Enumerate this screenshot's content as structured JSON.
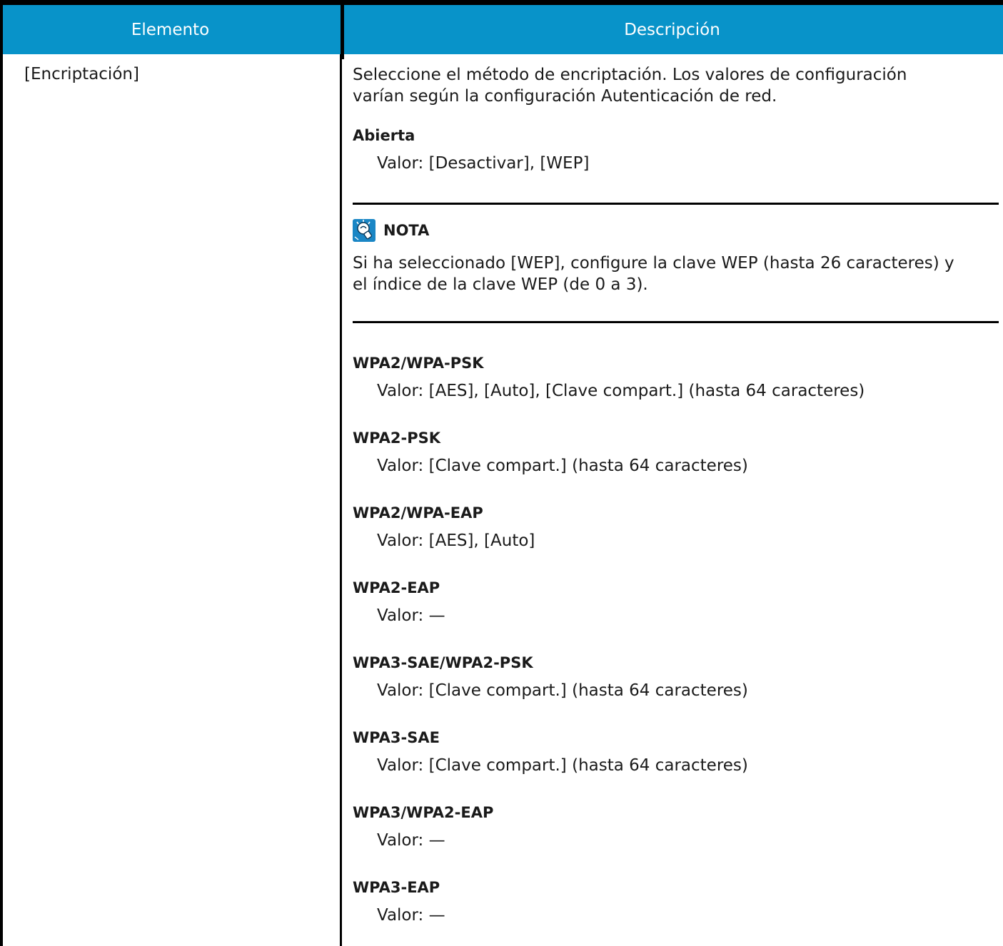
{
  "header": {
    "col1": "Elemento",
    "col2": "Descripción"
  },
  "row": {
    "item": "[Encriptación]",
    "intro_line1": "Seleccione el método de encriptación. Los valores de configuración",
    "intro_line2": "varían según la configuración Autenticación de red.",
    "open": {
      "title": "Abierta",
      "value": "Valor: [Desactivar], [WEP]"
    },
    "note": {
      "icon": "note-icon",
      "label": "NOTA",
      "line1": "Si ha seleccionado [WEP], configure la clave WEP (hasta 26 caracteres) y",
      "line2": "el índice de la clave WEP (de 0 a 3)."
    },
    "groups": [
      {
        "title": "WPA2/WPA-PSK",
        "value": "Valor: [AES], [Auto], [Clave compart.] (hasta 64 caracteres)"
      },
      {
        "title": "WPA2-PSK",
        "value": "Valor: [Clave compart.] (hasta 64 caracteres)"
      },
      {
        "title": "WPA2/WPA-EAP",
        "value": "Valor: [AES], [Auto]"
      },
      {
        "title": "WPA2-EAP",
        "value": "Valor: —"
      },
      {
        "title": "WPA3-SAE/WPA2-PSK",
        "value": "Valor: [Clave compart.] (hasta 64 caracteres)"
      },
      {
        "title": "WPA3-SAE",
        "value": "Valor: [Clave compart.] (hasta 64 caracteres)"
      },
      {
        "title": "WPA3/WPA2-EAP",
        "value": "Valor: —"
      },
      {
        "title": "WPA3-EAP",
        "value": "Valor: —"
      }
    ]
  },
  "colors": {
    "header_bg": "#0893c9",
    "header_text": "#ffffff",
    "border": "#000000",
    "note_icon": "#1a86c5"
  }
}
